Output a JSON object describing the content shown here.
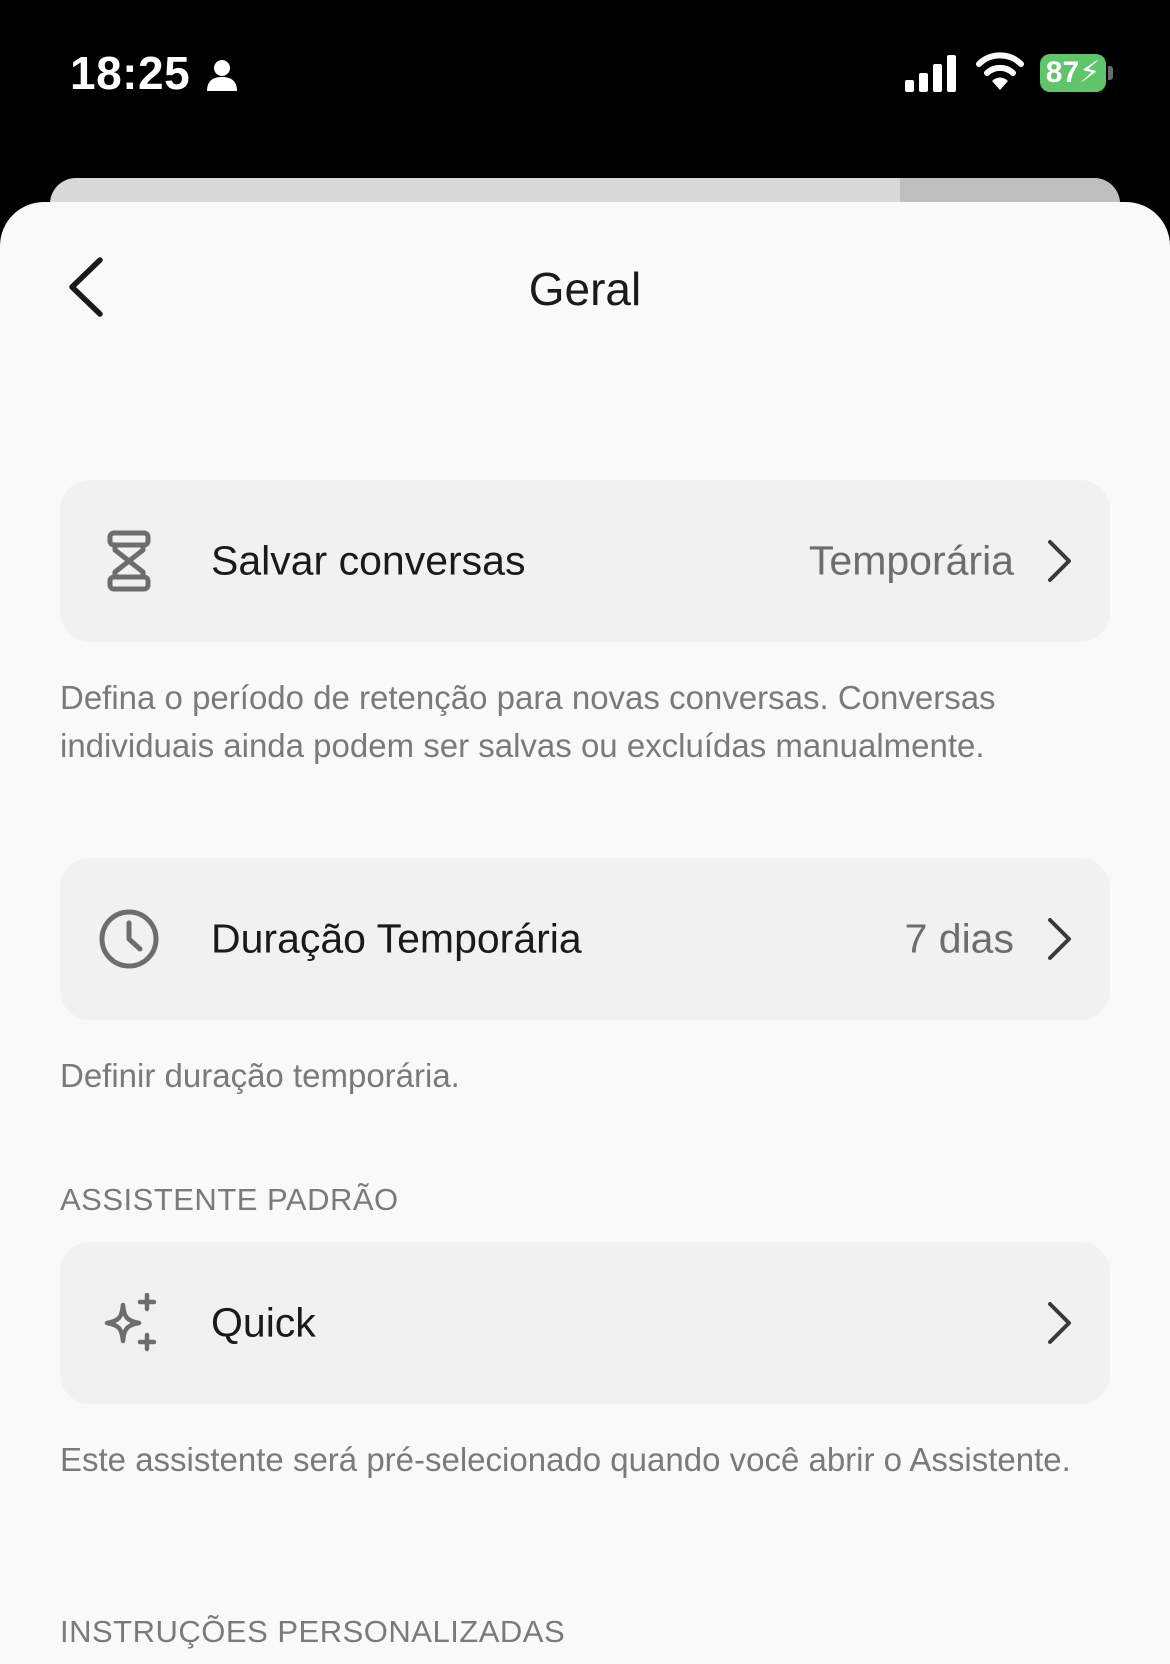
{
  "status_bar": {
    "time": "18:25",
    "battery": "87"
  },
  "header": {
    "title": "Geral"
  },
  "settings": {
    "save_chats": {
      "label": "Salvar conversas",
      "value": "Temporária",
      "description": "Defina o período de retenção para novas conversas. Conversas individuais ainda podem ser salvas ou excluídas manualmente.",
      "icon": "hourglass-icon"
    },
    "temp_duration": {
      "label": "Duração Temporária",
      "value": "7 dias",
      "description": "Definir duração temporária.",
      "icon": "clock-icon"
    },
    "default_assistant": {
      "section_header": "ASSISTENTE PADRÃO",
      "label": "Quick",
      "description": "Este assistente será pré-selecionado quando você abrir o Assistente.",
      "icon": "sparkles-icon"
    },
    "custom_instructions": {
      "section_header": "INSTRUÇÕES PERSONALIZADAS"
    }
  }
}
